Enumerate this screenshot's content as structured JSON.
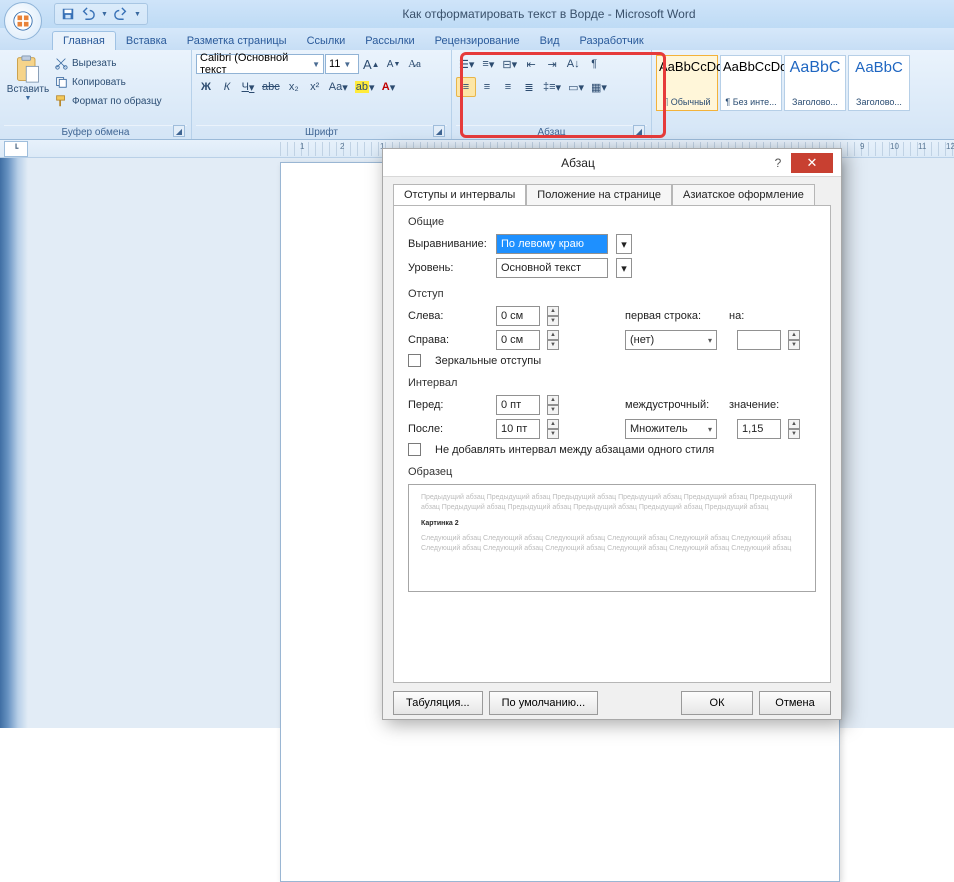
{
  "window": {
    "title": "Как отформатировать текст в Ворде - Microsoft Word"
  },
  "qat": {
    "save": "save",
    "undo": "undo",
    "redo": "redo"
  },
  "tabs": {
    "home": "Главная",
    "insert": "Вставка",
    "layout": "Разметка страницы",
    "refs": "Ссылки",
    "mail": "Рассылки",
    "review": "Рецензирование",
    "view": "Вид",
    "dev": "Разработчик"
  },
  "clipboard": {
    "paste": "Вставить",
    "cut": "Вырезать",
    "copy": "Копировать",
    "format_painter": "Формат по образцу",
    "group": "Буфер обмена"
  },
  "font": {
    "family": "Calibri (Основной текст",
    "size": "11",
    "grow": "A",
    "shrink": "A",
    "clear": "Aa",
    "bold": "Ж",
    "italic": "К",
    "underline": "Ч",
    "strike": "abc",
    "sub": "x₂",
    "sup": "x²",
    "case": "Aa",
    "highlight": "ab",
    "color": "A",
    "group": "Шрифт"
  },
  "paragraph": {
    "group": "Абзац"
  },
  "styles": {
    "s1": {
      "sample": "AaBbCcDd",
      "name": "¶ Обычный"
    },
    "s2": {
      "sample": "AaBbCcDd",
      "name": "¶ Без инте..."
    },
    "s3": {
      "sample": "АаBbC",
      "name": "Заголово..."
    },
    "s4": {
      "sample": "АаBbC",
      "name": "Заголово..."
    }
  },
  "ruler": {
    "n1": "1",
    "n2": "2",
    "n3": "1",
    "n4": "9",
    "n5": "10",
    "n6": "11",
    "n7": "12"
  },
  "dialog": {
    "title": "Абзац",
    "help": "?",
    "tabs": {
      "t1": "Отступы и интервалы",
      "t2": "Положение на странице",
      "t3": "Азиатское оформление"
    },
    "sec_general": "Общие",
    "align_label": "Выравнивание:",
    "align_value": "По левому краю",
    "level_label": "Уровень:",
    "level_value": "Основной текст",
    "sec_indent": "Отступ",
    "left_label": "Слева:",
    "left_value": "0 см",
    "right_label": "Справа:",
    "right_value": "0 см",
    "firstline_label": "первая строка:",
    "firstline_value": "(нет)",
    "by_label": "на:",
    "mirror": "Зеркальные отступы",
    "sec_spacing": "Интервал",
    "before_label": "Перед:",
    "before_value": "0 пт",
    "after_label": "После:",
    "after_value": "10 пт",
    "line_label": "междустрочный:",
    "line_value": "Множитель",
    "at_label": "значение:",
    "at_value": "1,15",
    "nospace": "Не добавлять интервал между абзацами одного стиля",
    "sec_preview": "Образец",
    "preview_prev": "Предыдущий абзац Предыдущий абзац Предыдущий абзац Предыдущий абзац Предыдущий абзац Предыдущий абзац Предыдущий абзац Предыдущий абзац Предыдущий абзац Предыдущий абзац Предыдущий абзац",
    "preview_cur": "Картинка 2",
    "preview_next": "Следующий абзац Следующий абзац Следующий абзац Следующий абзац Следующий абзац Следующий абзац Следующий абзац Следующий абзац Следующий абзац Следующий абзац Следующий абзац Следующий абзац",
    "btn_tabs": "Табуляция...",
    "btn_default": "По умолчанию...",
    "btn_ok": "ОК",
    "btn_cancel": "Отмена"
  }
}
